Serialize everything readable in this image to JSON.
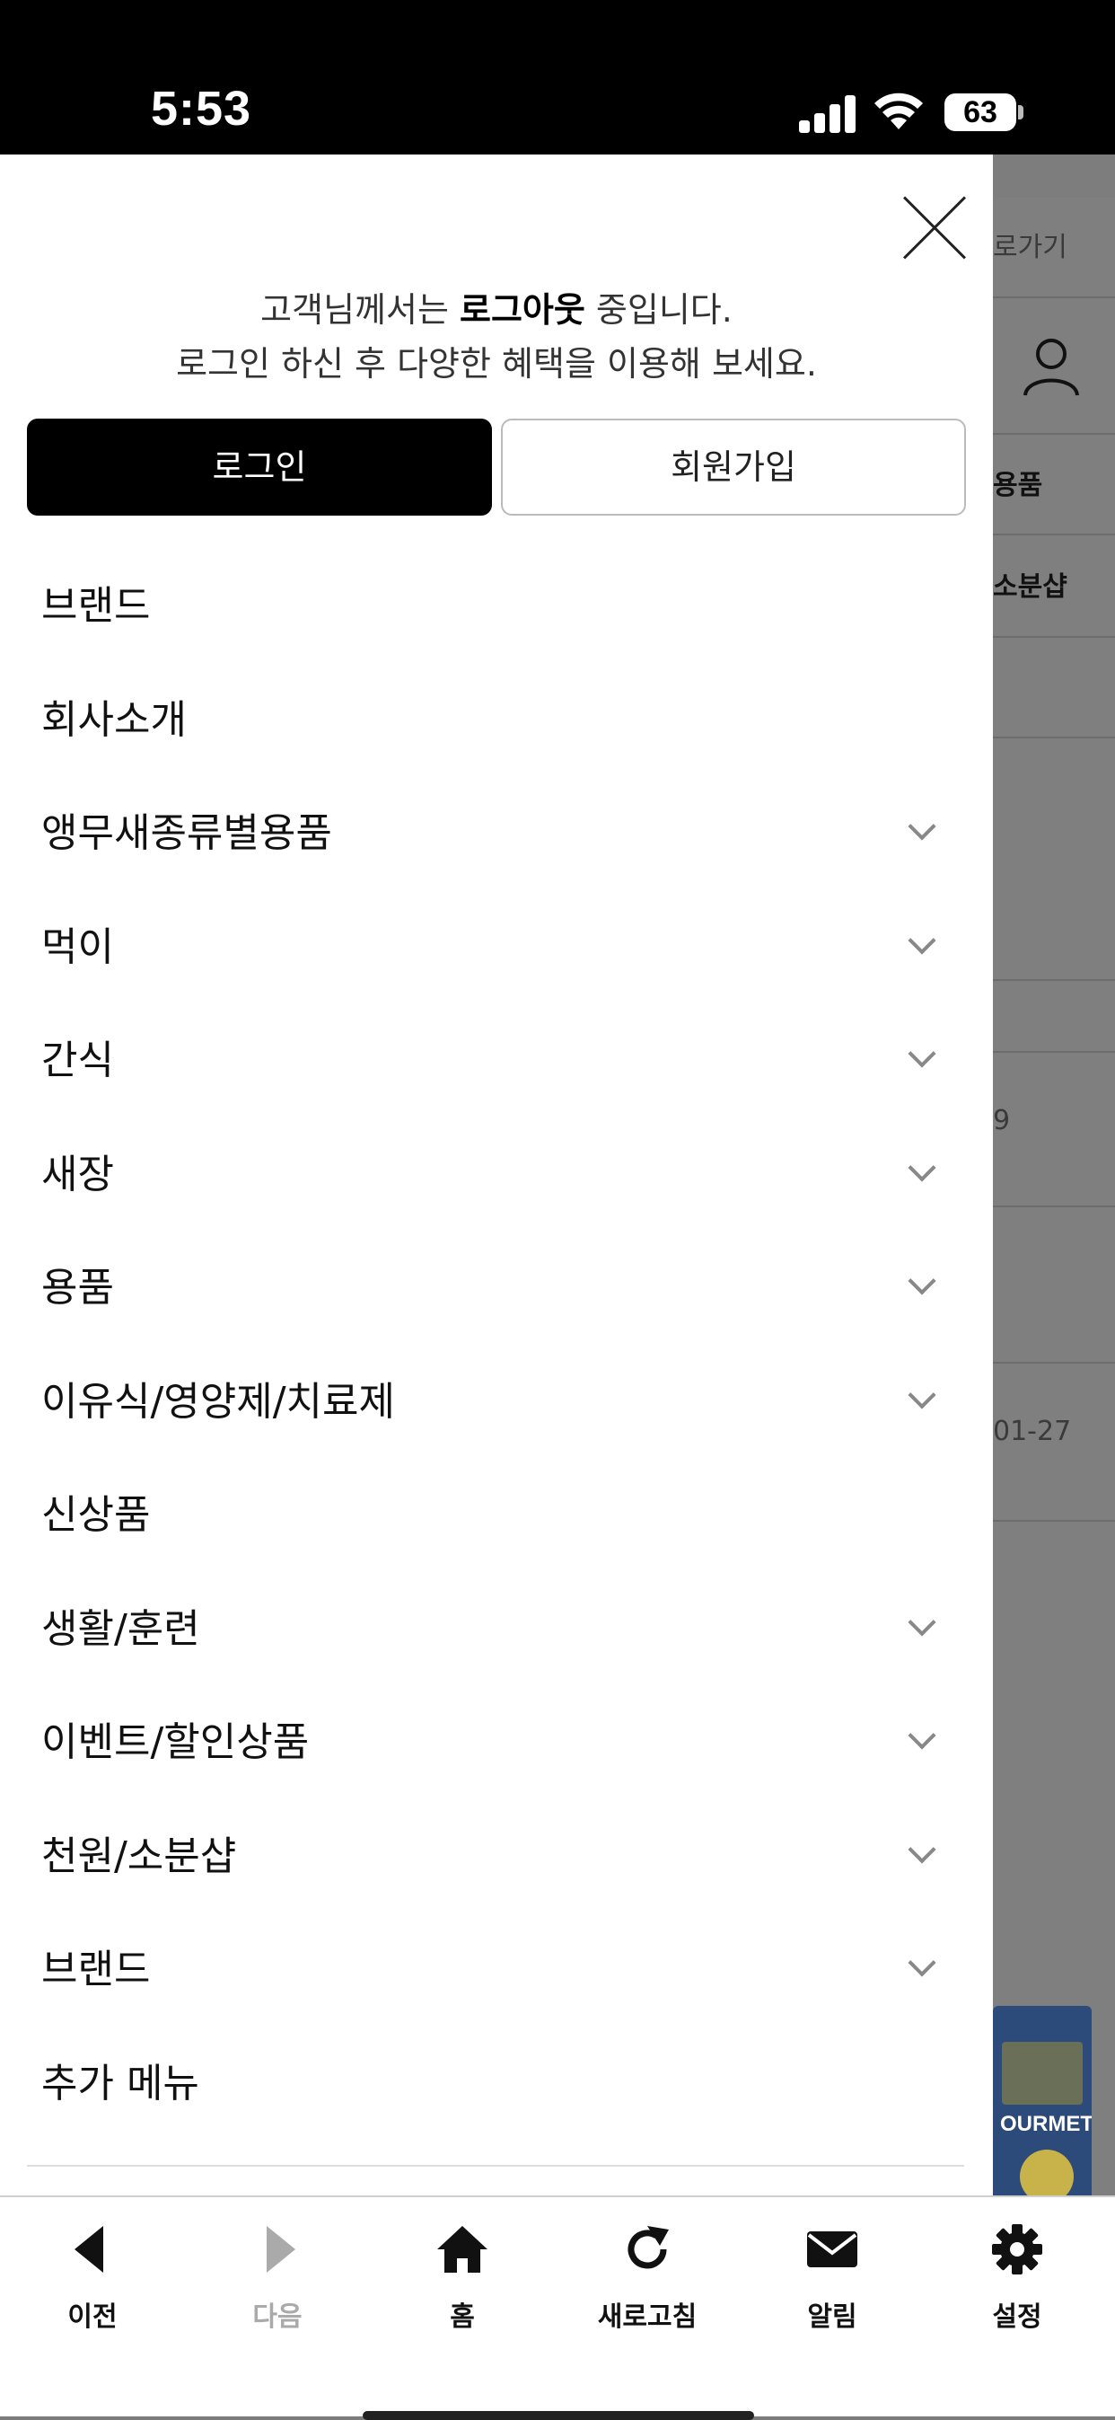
{
  "status_bar": {
    "time": "5:53",
    "battery": "63"
  },
  "background_page": {
    "texts": [
      "로가기",
      "용품",
      "소분샵",
      "9",
      "01-27"
    ],
    "product_label": "OURMET"
  },
  "drawer": {
    "greeting_prefix": "고객님께서는 ",
    "greeting_status": "로그아웃",
    "greeting_suffix": " 중입니다.",
    "greeting_line2": "로그인 하신 후 다양한 혜택을 이용해 보세요.",
    "login_label": "로그인",
    "join_label": "회원가입",
    "menu": [
      {
        "label": "브랜드",
        "expandable": false
      },
      {
        "label": "회사소개",
        "expandable": false
      },
      {
        "label": "앵무새종류별용품",
        "expandable": true
      },
      {
        "label": "먹이",
        "expandable": true
      },
      {
        "label": "간식",
        "expandable": true
      },
      {
        "label": "새장",
        "expandable": true
      },
      {
        "label": "용품",
        "expandable": true
      },
      {
        "label": "이유식/영양제/치료제",
        "expandable": true
      },
      {
        "label": "신상품",
        "expandable": false
      },
      {
        "label": "생활/훈련",
        "expandable": true
      },
      {
        "label": "이벤트/할인상품",
        "expandable": true
      },
      {
        "label": "천원/소분샵",
        "expandable": true
      },
      {
        "label": "브랜드",
        "expandable": true
      },
      {
        "label": "추가 메뉴",
        "expandable": false
      }
    ]
  },
  "tabbar": {
    "items": [
      {
        "label": "이전",
        "icon": "back-triangle-icon"
      },
      {
        "label": "다음",
        "icon": "forward-triangle-icon"
      },
      {
        "label": "홈",
        "icon": "home-icon"
      },
      {
        "label": "새로고침",
        "icon": "refresh-icon"
      },
      {
        "label": "알림",
        "icon": "mail-icon"
      },
      {
        "label": "설정",
        "icon": "gear-icon"
      }
    ]
  },
  "colors": {
    "primary_button": "#000000",
    "overlay": "#7d7d7d",
    "disabled": "#aaaaaa"
  }
}
